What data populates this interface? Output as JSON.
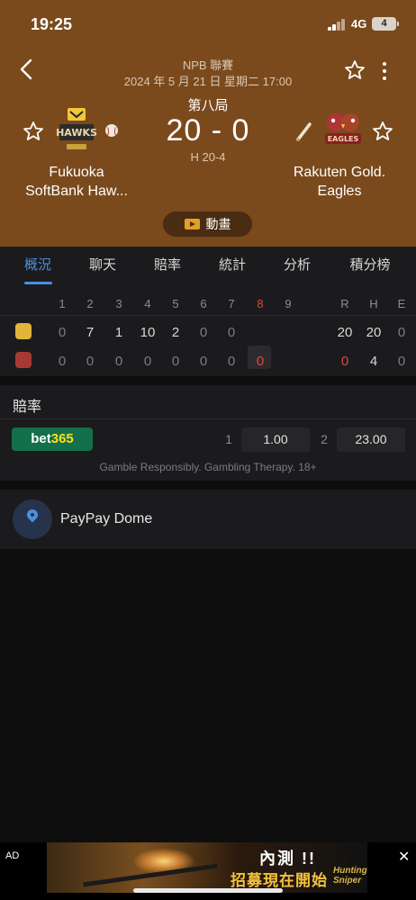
{
  "status_bar": {
    "time": "19:25",
    "network": "4G",
    "battery": "4"
  },
  "header": {
    "league": "NPB 聯賽",
    "datetime": "2024 年 5 月 21 日 星期二 17:00",
    "inning": "第八局",
    "score": "20 - 0",
    "hits": "H 20-4",
    "home_team": {
      "name_line1": "Fukuoka",
      "name_line2": "SoftBank Haw...",
      "logo_text": "HAWKS"
    },
    "away_team": {
      "name_line1": "Rakuten Gold.",
      "name_line2": "Eagles",
      "logo_text": "EAGLES"
    },
    "video_label": "動畫",
    "colors": {
      "header_bg": "#7a4a1d",
      "accent": "#e2a126"
    }
  },
  "tabs": [
    {
      "label": "概況",
      "active": true
    },
    {
      "label": "聊天",
      "active": false
    },
    {
      "label": "賠率",
      "active": false
    },
    {
      "label": "統計",
      "active": false
    },
    {
      "label": "分析",
      "active": false
    },
    {
      "label": "積分榜",
      "active": false
    }
  ],
  "scoreboard": {
    "headers": [
      "1",
      "2",
      "3",
      "4",
      "5",
      "6",
      "7",
      "8",
      "9",
      "R",
      "H",
      "E"
    ],
    "current_inning": "8",
    "home": [
      "0",
      "7",
      "1",
      "10",
      "2",
      "0",
      "0",
      "",
      "",
      "20",
      "20",
      "0"
    ],
    "away": [
      "0",
      "0",
      "0",
      "0",
      "0",
      "0",
      "0",
      "0",
      "",
      "0",
      "4",
      "0"
    ]
  },
  "odds": {
    "title": "賠率",
    "bookmaker_part1": "bet",
    "bookmaker_part2": "365",
    "options": [
      {
        "index": "1",
        "value": "1.00"
      },
      {
        "index": "2",
        "value": "23.00"
      }
    ],
    "note": "Gamble Responsibly. Gambling Therapy. 18+"
  },
  "venue": {
    "name": "PayPay Dome"
  },
  "ad": {
    "label": "AD",
    "line1": "內測 !!",
    "line2": "招募現在開始",
    "brand": "Hunting Sniper",
    "close": "✕"
  }
}
